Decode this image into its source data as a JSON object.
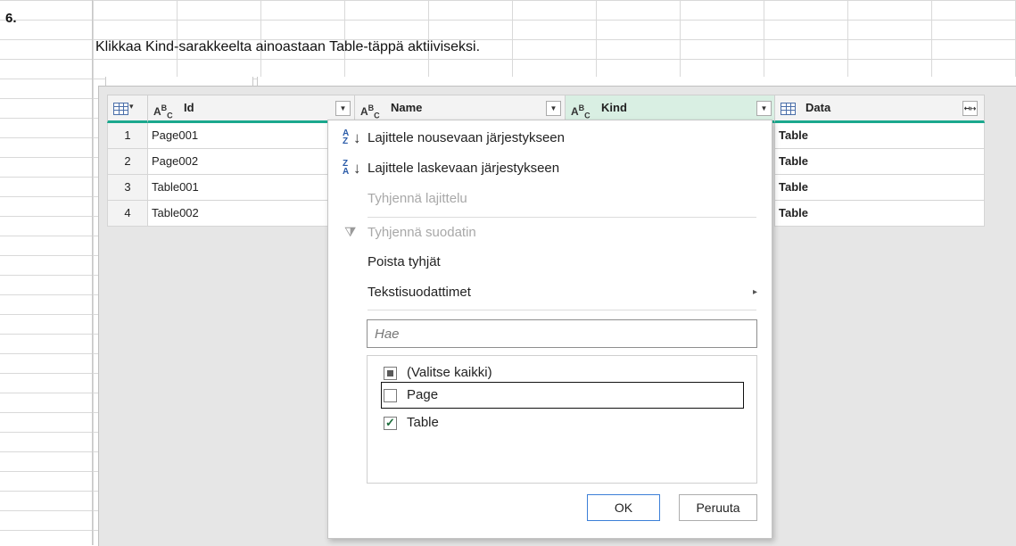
{
  "step_number": "6.",
  "instruction": "Klikkaa Kind-sarakkeelta ainoastaan Table-täppä aktiiviseksi.",
  "table": {
    "columns": [
      {
        "label": "Id",
        "type": "ABC"
      },
      {
        "label": "Name",
        "type": "ABC"
      },
      {
        "label": "Kind",
        "type": "ABC"
      },
      {
        "label": "Data",
        "type": "table"
      }
    ],
    "rows": [
      {
        "num": "1",
        "id": "Page001",
        "data": "Table"
      },
      {
        "num": "2",
        "id": "Page002",
        "data": "Table"
      },
      {
        "num": "3",
        "id": "Table001",
        "data": "Table"
      },
      {
        "num": "4",
        "id": "Table002",
        "data": "Table"
      }
    ]
  },
  "menu": {
    "sort_asc": "Lajittele nousevaan järjestykseen",
    "sort_desc": "Lajittele laskevaan järjestykseen",
    "clear_sort": "Tyhjennä lajittelu",
    "clear_filter": "Tyhjennä suodatin",
    "remove_empty": "Poista tyhjät",
    "text_filters": "Tekstisuodattimet",
    "search_placeholder": "Hae",
    "items": [
      {
        "label": "(Valitse kaikki)",
        "state": "partial"
      },
      {
        "label": "Page",
        "state": "unchecked"
      },
      {
        "label": "Table",
        "state": "checked"
      }
    ],
    "ok_label": "OK",
    "cancel_label": "Peruuta"
  }
}
